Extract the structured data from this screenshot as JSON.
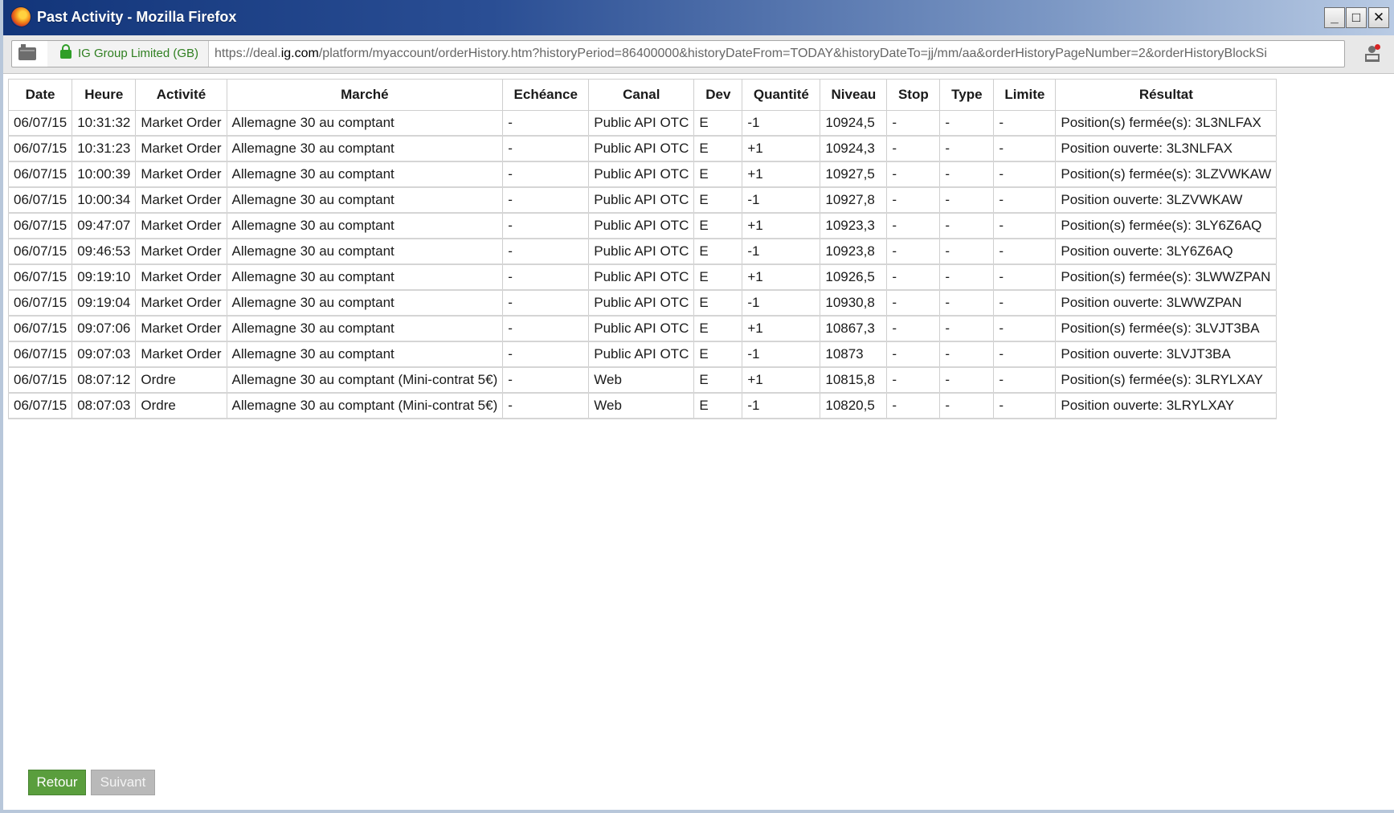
{
  "window": {
    "title": "Past Activity - Mozilla Firefox",
    "controls": {
      "minimize": "_",
      "maximize": "□",
      "close": "✕"
    }
  },
  "urlbar": {
    "identity": "IG Group Limited (GB)",
    "url_prefix": "https://deal.",
    "url_domain": "ig.com",
    "url_rest": "/platform/myaccount/orderHistory.htm?historyPeriod=86400000&historyDateFrom=TODAY&historyDateTo=jj/mm/aa&orderHistoryPageNumber=2&orderHistoryBlockSi"
  },
  "table": {
    "headers": [
      "Date",
      "Heure",
      "Activité",
      "Marché",
      "Echéance",
      "Canal",
      "Dev",
      "Quantité",
      "Niveau",
      "Stop",
      "Type",
      "Limite",
      "Résultat"
    ],
    "rows": [
      [
        "06/07/15",
        "10:31:32",
        "Market Order",
        "Allemagne 30 au comptant",
        "-",
        "Public API OTC",
        "E",
        "-1",
        "10924,5",
        "-",
        "-",
        "-",
        "Position(s) fermée(s): 3L3NLFAX"
      ],
      [
        "06/07/15",
        "10:31:23",
        "Market Order",
        "Allemagne 30 au comptant",
        "-",
        "Public API OTC",
        "E",
        "+1",
        "10924,3",
        "-",
        "-",
        "-",
        "Position ouverte: 3L3NLFAX"
      ],
      [
        "06/07/15",
        "10:00:39",
        "Market Order",
        "Allemagne 30 au comptant",
        "-",
        "Public API OTC",
        "E",
        "+1",
        "10927,5",
        "-",
        "-",
        "-",
        "Position(s) fermée(s): 3LZVWKAW"
      ],
      [
        "06/07/15",
        "10:00:34",
        "Market Order",
        "Allemagne 30 au comptant",
        "-",
        "Public API OTC",
        "E",
        "-1",
        "10927,8",
        "-",
        "-",
        "-",
        "Position ouverte: 3LZVWKAW"
      ],
      [
        "06/07/15",
        "09:47:07",
        "Market Order",
        "Allemagne 30 au comptant",
        "-",
        "Public API OTC",
        "E",
        "+1",
        "10923,3",
        "-",
        "-",
        "-",
        "Position(s) fermée(s): 3LY6Z6AQ"
      ],
      [
        "06/07/15",
        "09:46:53",
        "Market Order",
        "Allemagne 30 au comptant",
        "-",
        "Public API OTC",
        "E",
        "-1",
        "10923,8",
        "-",
        "-",
        "-",
        "Position ouverte: 3LY6Z6AQ"
      ],
      [
        "06/07/15",
        "09:19:10",
        "Market Order",
        "Allemagne 30 au comptant",
        "-",
        "Public API OTC",
        "E",
        "+1",
        "10926,5",
        "-",
        "-",
        "-",
        "Position(s) fermée(s): 3LWWZPAN"
      ],
      [
        "06/07/15",
        "09:19:04",
        "Market Order",
        "Allemagne 30 au comptant",
        "-",
        "Public API OTC",
        "E",
        "-1",
        "10930,8",
        "-",
        "-",
        "-",
        "Position ouverte: 3LWWZPAN"
      ],
      [
        "06/07/15",
        "09:07:06",
        "Market Order",
        "Allemagne 30 au comptant",
        "-",
        "Public API OTC",
        "E",
        "+1",
        "10867,3",
        "-",
        "-",
        "-",
        "Position(s) fermée(s): 3LVJT3BA"
      ],
      [
        "06/07/15",
        "09:07:03",
        "Market Order",
        "Allemagne 30 au comptant",
        "-",
        "Public API OTC",
        "E",
        "-1",
        "10873",
        "-",
        "-",
        "-",
        "Position ouverte: 3LVJT3BA"
      ],
      [
        "06/07/15",
        "08:07:12",
        "Ordre",
        "Allemagne 30 au comptant (Mini-contrat 5€)",
        "-",
        "Web",
        "E",
        "+1",
        "10815,8",
        "-",
        "-",
        "-",
        "Position(s) fermée(s): 3LRYLXAY"
      ],
      [
        "06/07/15",
        "08:07:03",
        "Ordre",
        "Allemagne 30 au comptant (Mini-contrat 5€)",
        "-",
        "Web",
        "E",
        "-1",
        "10820,5",
        "-",
        "-",
        "-",
        "Position ouverte: 3LRYLXAY"
      ]
    ]
  },
  "buttons": {
    "back": "Retour",
    "next": "Suivant"
  },
  "colors": {
    "back_button": "#5a9e3d",
    "next_button_disabled": "#b9b9b9",
    "secure_identity": "#2f7f20"
  }
}
